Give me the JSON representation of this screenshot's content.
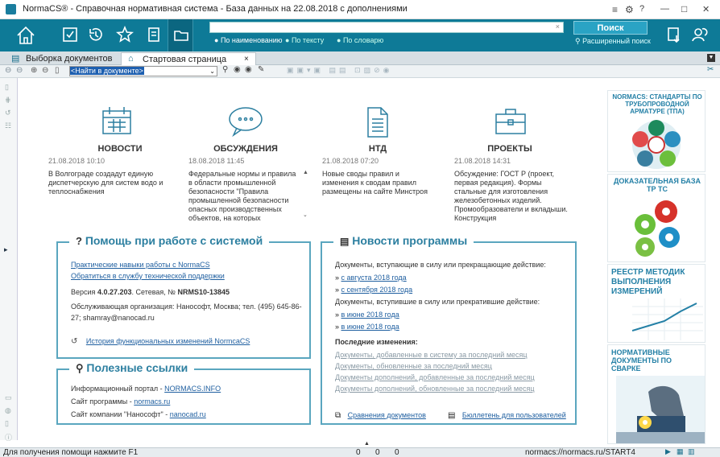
{
  "window": {
    "title": "NormaCS® - Справочная нормативная система - База данных на 22.08.2018 с дополнениями",
    "menu_icon": "hamburger-icon",
    "minimize": "—",
    "maximize": "□",
    "close": "✕"
  },
  "toolbar": {
    "search_value": "",
    "search_button": "Поиск",
    "advanced_search": "Расширенный поиск",
    "mode_by_name": "По наименованию",
    "mode_by_text": "По тексту",
    "mode_by_dict": "По словарю"
  },
  "tabs": [
    {
      "label": "Выборка документов"
    },
    {
      "label": "Стартовая страница"
    }
  ],
  "find_bar": {
    "value": "<Найти в документе>"
  },
  "news": [
    {
      "heading": "НОВОСТИ",
      "date": "21.08.2018 10:10",
      "text": "В Волгограде создадут единую диспетчерскую для систем водо и теплоснабжения"
    },
    {
      "heading": "ОБСУЖДЕНИЯ",
      "date": "18.08.2018 11:45",
      "text": "Федеральные нормы и правила в области промышленной безопасности \"Правила промышленной безопасности опасных производственных объектов, на которых"
    },
    {
      "heading": "НТД",
      "date": "21.08.2018 07:20",
      "text": "Новые своды правил и изменения к сводам правил размещены на сайте Минстроя"
    },
    {
      "heading": "ПРОЕКТЫ",
      "date": "21.08.2018 14:31",
      "text": "Обсуждение: ГОСТ Р (проект, первая редакция). Формы стальные для изготовления железобетонных изделий. Промообразователи и вкладыши. Конструкция"
    }
  ],
  "help": {
    "title": "Помощь при работе с системой",
    "link1": "Практические навыки работы с NormaCS",
    "link2": "Обратиться в службу технической поддержки",
    "version_prefix": "Версия",
    "version": "4.0.27.203",
    "version_mid": ". Сетевая, №",
    "license": "NRMS10-13845",
    "service": "Обслуживающая организация: Нанософт, Москва; тел. (495) 645-86-27; shamray@nanocad.ru",
    "history": "История функциональных изменений NormcaCS"
  },
  "links": {
    "title": "Полезные ссылки",
    "row1_label": "Информационный портал -",
    "row1_link": "NORMACS.INFO",
    "row2_label": "Сайт программы -",
    "row2_link": "normacs.ru",
    "row3_label": "Сайт компании \"Нанософт\" -",
    "row3_link": "nanocad.ru"
  },
  "program_news": {
    "title": "Новости программы",
    "in_force": "Документы, вступающие в силу или прекращающие действие:",
    "in_force_links": [
      "с августа 2018 года",
      "с сентября 2018 года"
    ],
    "entered": "Документы, вступившие в силу или прекратившие действие:",
    "entered_links": [
      "в июне 2018 года",
      "в июне 2018 года"
    ],
    "last_changes": "Последние изменения:",
    "changes": [
      "Документы, добавленные в систему за последний месяц",
      "Документы, обновленные за последний месяц",
      "Документы дополнений, добавленные за последний месяц",
      "Документы дополнений, обновленные за последний месяц"
    ],
    "compare": "Сравнения документов",
    "bulletin": "Бюллетень для пользователей"
  },
  "ads": [
    {
      "text": "NORMACS: СТАНДАРТЫ ПО ТРУБОПРОВОДНОЙ АРМАТУРЕ (ТПА)"
    },
    {
      "text": "ДОКАЗАТЕЛЬНАЯ БАЗА ТР ТС"
    },
    {
      "text": "РЕЕСТР МЕТОДИК ВЫПОЛНЕНИЯ ИЗМЕРЕНИЙ"
    },
    {
      "text": "НОРМАТИВНЫЕ ДОКУМЕНТЫ ПО СВАРКЕ"
    }
  ],
  "status": {
    "hint": "Для получения помощи нажмите F1",
    "c1": "0",
    "c2": "0",
    "c3": "0",
    "url": "normacs://normacs.ru/START4"
  },
  "colors": {
    "toolbar": "#0e7a97",
    "accent": "#2c7fa0",
    "box_border": "#5aa6bf"
  }
}
